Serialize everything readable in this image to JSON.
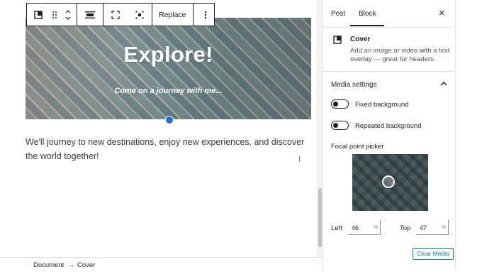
{
  "toolbar": {
    "replace_label": "Replace",
    "more_icon": "more-vertical-icon",
    "icons": [
      "block-cover-icon",
      "drag-handle-icon",
      "move-up-down-icon",
      "align-icon",
      "full-height-icon",
      "content-position-icon"
    ]
  },
  "cover": {
    "title": "Explore!",
    "subtitle": "Come on a journey with me..."
  },
  "paragraph": {
    "text": "We'll journey to new destinations, enjoy new experiences, and discover the world together!"
  },
  "sidebar": {
    "tabs": [
      {
        "label": "Post",
        "active": false
      },
      {
        "label": "Block",
        "active": true
      }
    ],
    "block": {
      "name": "Cover",
      "description": "Add an image or video with a text overlay — great for headers."
    },
    "media_settings": {
      "title": "Media settings",
      "fixed_background": "Fixed background",
      "repeated_background": "Repeated background",
      "focal_point_label": "Focal point picker",
      "left_label": "Left",
      "left_value": "46",
      "top_label": "Top",
      "top_value": "47",
      "unit": "%",
      "clear_media": "Clear Media"
    }
  },
  "breadcrumb": {
    "items": [
      "Document",
      "Cover"
    ],
    "separator": "→"
  },
  "colors": {
    "accent": "#1e73be",
    "link": "#2271b1",
    "text": "#1e1e1e"
  }
}
